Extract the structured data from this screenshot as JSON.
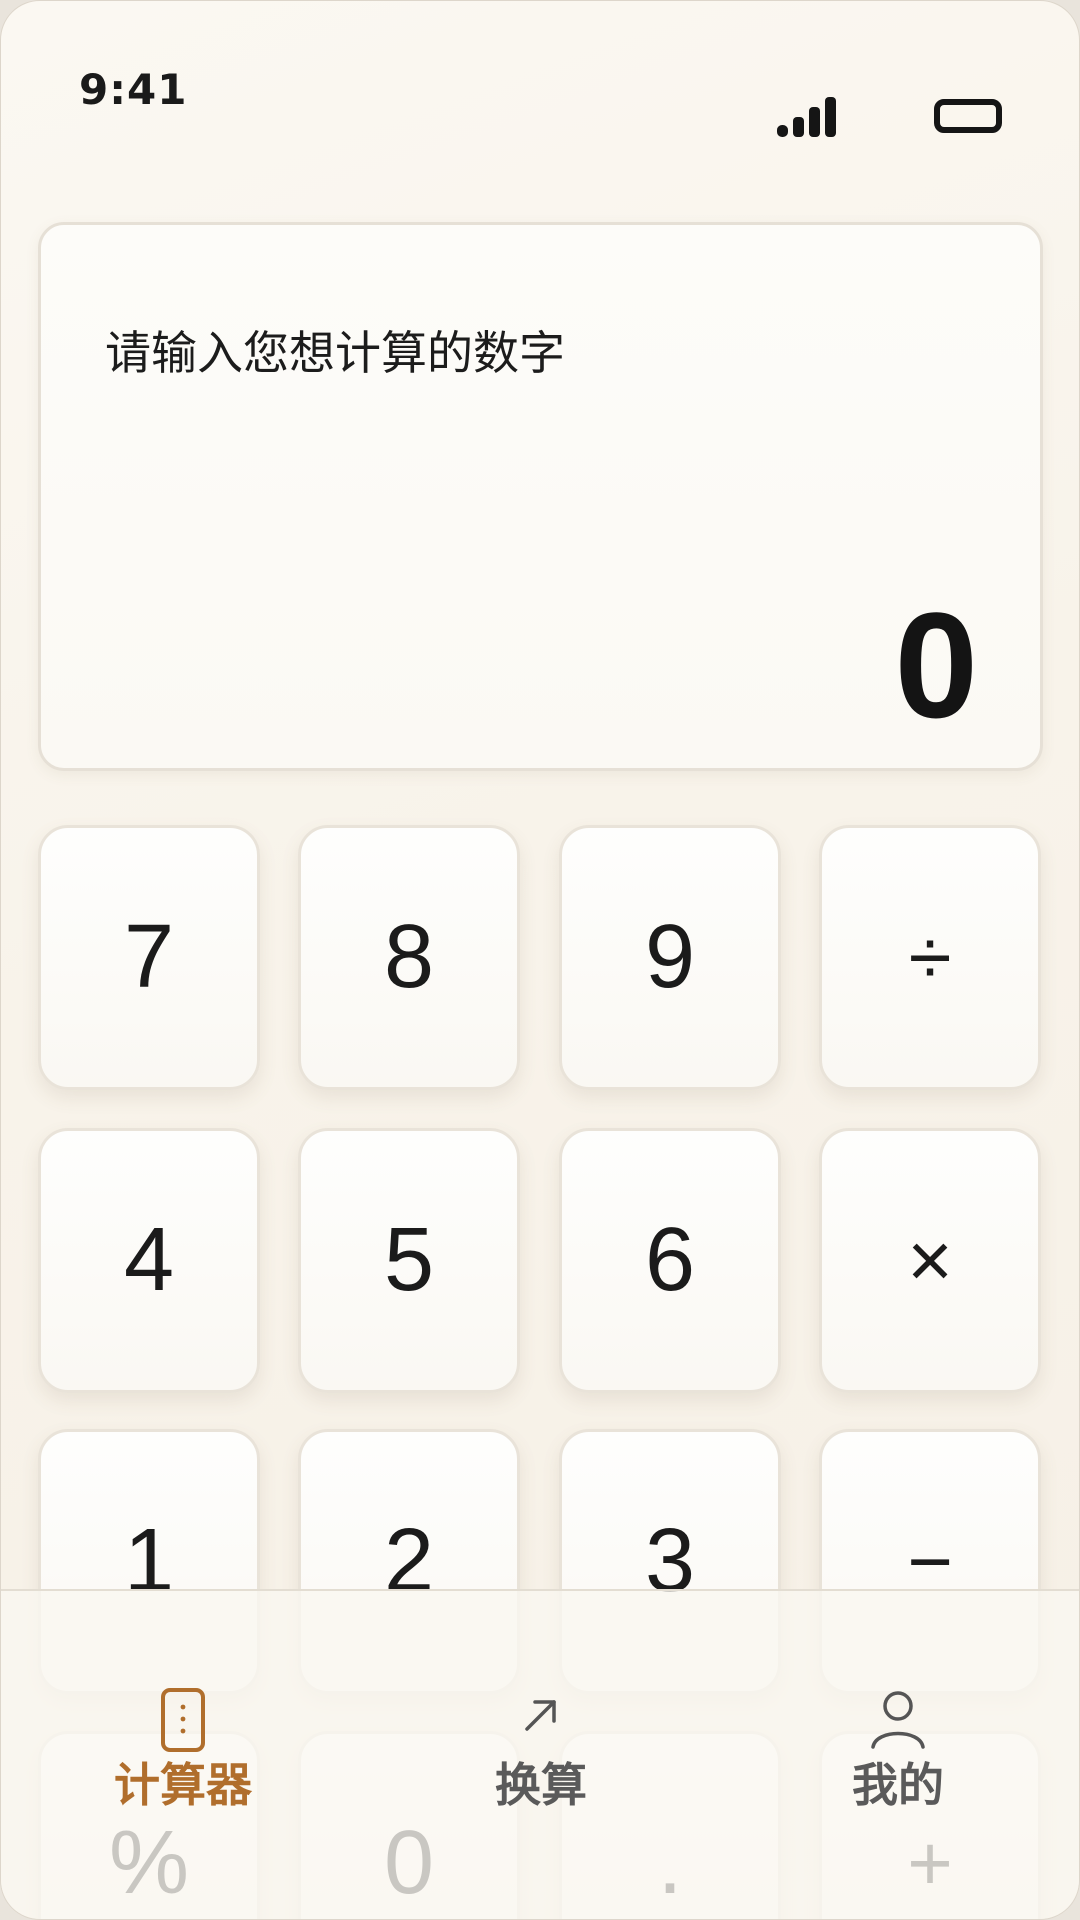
{
  "status_bar": {
    "time": "9:41",
    "signal_icon": "signal-bars-icon",
    "battery_icon": "battery-icon"
  },
  "display": {
    "prompt": "请输入您想计算的数字",
    "value": "0"
  },
  "keypad": {
    "keys": [
      "7",
      "8",
      "9",
      "÷",
      "4",
      "5",
      "6",
      "×",
      "1",
      "2",
      "3",
      "−",
      "%",
      "0",
      ".",
      "+"
    ]
  },
  "tabbar": {
    "calculator": {
      "label": "计算器",
      "icon": "calculator-icon"
    },
    "convert": {
      "label": "换算",
      "icon": "arrow-up-right-icon"
    },
    "me": {
      "label": "我的",
      "icon": "user-icon"
    }
  },
  "colors": {
    "accent": "#b06e2c",
    "background": "#f8f3ea",
    "text": "#1b1b1b",
    "inactive_tab": "#5a5a5a"
  }
}
